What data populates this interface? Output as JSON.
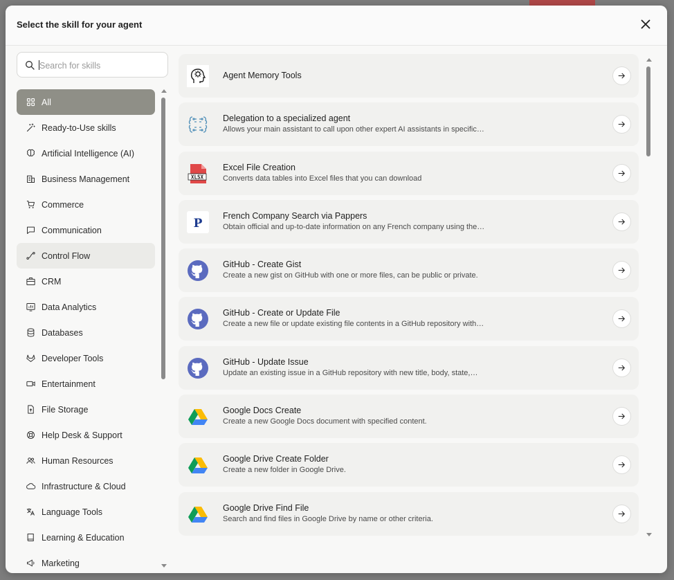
{
  "modal": {
    "title": "Select the skill for your agent",
    "close_icon": "close-icon"
  },
  "search": {
    "placeholder": "Search for skills",
    "value": "",
    "icon": "search-icon"
  },
  "categories": [
    {
      "label": "All",
      "icon": "grid-icon",
      "state": "selected"
    },
    {
      "label": "Ready-to-Use skills",
      "icon": "magic-wand-icon"
    },
    {
      "label": "Artificial Intelligence (AI)",
      "icon": "brain-icon"
    },
    {
      "label": "Business Management",
      "icon": "building-icon"
    },
    {
      "label": "Commerce",
      "icon": "cart-icon"
    },
    {
      "label": "Communication",
      "icon": "chat-icon"
    },
    {
      "label": "Control Flow",
      "icon": "flow-icon",
      "state": "hover"
    },
    {
      "label": "CRM",
      "icon": "briefcase-icon"
    },
    {
      "label": "Data Analytics",
      "icon": "analytics-icon"
    },
    {
      "label": "Databases",
      "icon": "database-icon"
    },
    {
      "label": "Developer Tools",
      "icon": "gitlab-icon"
    },
    {
      "label": "Entertainment",
      "icon": "video-icon"
    },
    {
      "label": "File Storage",
      "icon": "file-upload-icon"
    },
    {
      "label": "Help Desk & Support",
      "icon": "lifebuoy-icon"
    },
    {
      "label": "Human Resources",
      "icon": "users-icon"
    },
    {
      "label": "Infrastructure & Cloud",
      "icon": "cloud-icon"
    },
    {
      "label": "Language Tools",
      "icon": "translate-icon"
    },
    {
      "label": "Learning & Education",
      "icon": "book-icon"
    },
    {
      "label": "Marketing",
      "icon": "megaphone-icon"
    }
  ],
  "skills": [
    {
      "name": "Agent Memory Tools",
      "description": "",
      "icon": "head-memory-icon"
    },
    {
      "name": "Delegation to a specialized agent",
      "description": "Allows your main assistant to call upon other expert AI assistants in specific…",
      "icon": "brain-network-icon"
    },
    {
      "name": "Excel File Creation",
      "description": "Converts data tables into Excel files that you can download",
      "icon": "xlsx-file-icon",
      "icon_text": "XLSX"
    },
    {
      "name": "French Company Search via Pappers",
      "description": "Obtain official and up-to-date information on any French company using the…",
      "icon": "pappers-logo-icon",
      "icon_text": "P"
    },
    {
      "name": "GitHub - Create Gist",
      "description": "Create a new gist on GitHub with one or more files, can be public or private.",
      "icon": "github-icon"
    },
    {
      "name": "GitHub - Create or Update File",
      "description": "Create a new file or update existing file contents in a GitHub repository with…",
      "icon": "github-icon"
    },
    {
      "name": "GitHub - Update Issue",
      "description": "Update an existing issue in a GitHub repository with new title, body, state,…",
      "icon": "github-icon"
    },
    {
      "name": "Google Docs Create",
      "description": "Create a new Google Docs document with specified content.",
      "icon": "google-drive-icon"
    },
    {
      "name": "Google Drive Create Folder",
      "description": "Create a new folder in Google Drive.",
      "icon": "google-drive-icon"
    },
    {
      "name": "Google Drive Find File",
      "description": "Search and find files in Google Drive by name or other criteria.",
      "icon": "google-drive-icon"
    }
  ],
  "colors": {
    "selected_bg": "#8f8f87",
    "hover_bg": "#ebebe8",
    "card_bg": "#f1f1ef",
    "github": "#5b6bbf",
    "excel_red": "#e04848",
    "pappers_blue": "#1d3b8f"
  }
}
